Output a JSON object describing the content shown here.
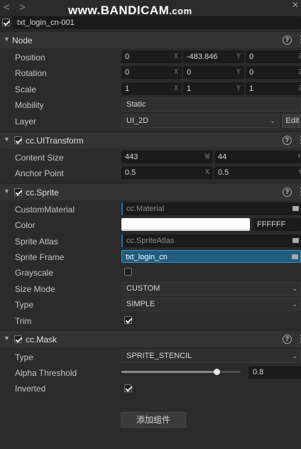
{
  "watermark": {
    "main": "www.BANDICAM",
    "suffix": ".com"
  },
  "nav": {
    "back": "<",
    "forward": ">",
    "pin": "✕"
  },
  "node_name": "txt_login_cn-001",
  "node": {
    "title": "Node",
    "position": {
      "label": "Position",
      "x": "0",
      "y": "-483.846",
      "z": "0"
    },
    "rotation": {
      "label": "Rotation",
      "x": "0",
      "y": "0",
      "z": "0"
    },
    "scale": {
      "label": "Scale",
      "x": "1",
      "y": "1",
      "z": "1"
    },
    "mobility": {
      "label": "Mobility",
      "value": "Static"
    },
    "layer": {
      "label": "Layer",
      "value": "UI_2D",
      "edit": "Edit"
    }
  },
  "ui_transform": {
    "title": "cc.UITransform",
    "content_size": {
      "label": "Content Size",
      "w": "443",
      "h": "44"
    },
    "anchor_point": {
      "label": "Anchor Point",
      "x": "0.5",
      "y": "0.5"
    }
  },
  "sprite": {
    "title": "cc.Sprite",
    "custom_material": {
      "label": "CustomMaterial",
      "value": "cc.Material"
    },
    "color": {
      "label": "Color",
      "hex": "FFFFFF",
      "swatch": "#ffffff"
    },
    "sprite_atlas": {
      "label": "Sprite Atlas",
      "value": "cc.SpriteAtlas"
    },
    "sprite_frame": {
      "label": "Sprite Frame",
      "value": "txt_login_cn"
    },
    "grayscale": {
      "label": "Grayscale",
      "checked": false
    },
    "size_mode": {
      "label": "Size Mode",
      "value": "CUSTOM"
    },
    "type": {
      "label": "Type",
      "value": "SIMPLE"
    },
    "trim": {
      "label": "Trim",
      "checked": true
    }
  },
  "mask": {
    "title": "cc.Mask",
    "type": {
      "label": "Type",
      "value": "SPRITE_STENCIL"
    },
    "alpha_threshold": {
      "label": "Alpha Threshold",
      "value": "0.8",
      "fraction": 0.8
    },
    "inverted": {
      "label": "Inverted",
      "checked": true
    }
  },
  "add_component": "添加组件",
  "axis_labels": {
    "x": "X",
    "y": "Y",
    "z": "Z",
    "w": "W",
    "h": "H"
  },
  "icons": {
    "help": "?",
    "more": "⋮",
    "caret": "▼",
    "arrow": "⌄"
  }
}
